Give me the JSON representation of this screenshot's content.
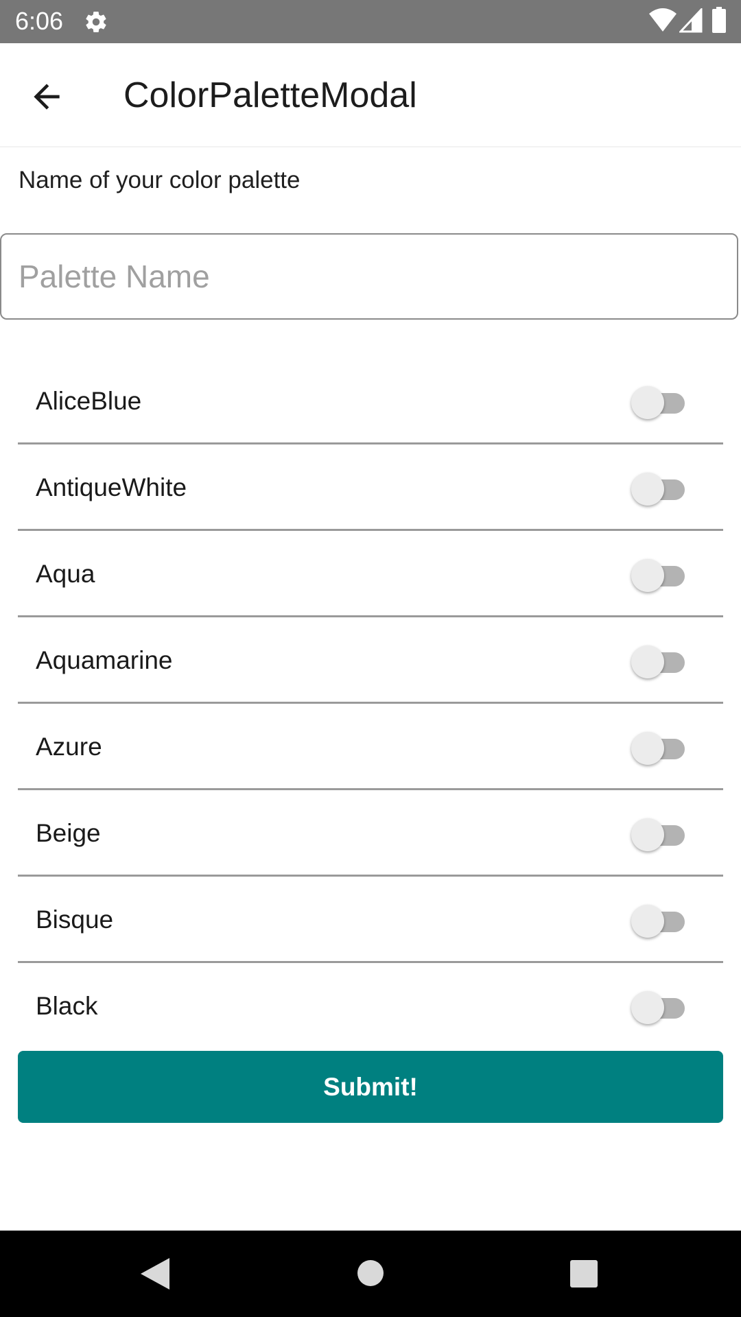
{
  "status_bar": {
    "time": "6:06",
    "icons": [
      "settings-icon",
      "wifi-icon",
      "signal-icon",
      "battery-icon"
    ]
  },
  "app_bar": {
    "title": "ColorPaletteModal",
    "back_icon": "arrow-back-icon"
  },
  "form": {
    "label": "Name of your color palette",
    "palette_name": {
      "value": "",
      "placeholder": "Palette Name"
    }
  },
  "colors": [
    {
      "name": "AliceBlue",
      "enabled": false
    },
    {
      "name": "AntiqueWhite",
      "enabled": false
    },
    {
      "name": "Aqua",
      "enabled": false
    },
    {
      "name": "Aquamarine",
      "enabled": false
    },
    {
      "name": "Azure",
      "enabled": false
    },
    {
      "name": "Beige",
      "enabled": false
    },
    {
      "name": "Bisque",
      "enabled": false
    },
    {
      "name": "Black",
      "enabled": false
    }
  ],
  "submit": {
    "label": "Submit!",
    "color": "#008080"
  },
  "nav_bar": {
    "icons": [
      "nav-back-icon",
      "nav-home-icon",
      "nav-recents-icon"
    ]
  }
}
